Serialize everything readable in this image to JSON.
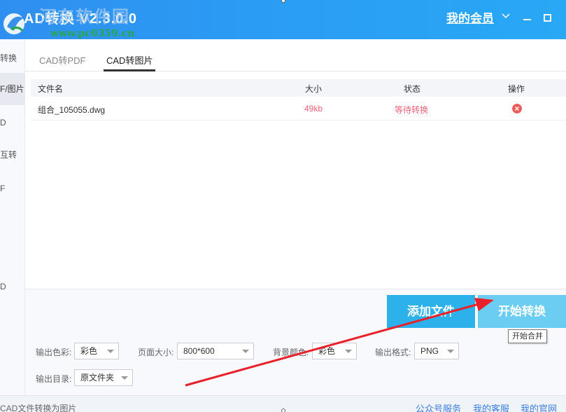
{
  "titlebar": {
    "app_title": "AD转换 V2.3.0.0",
    "watermark_site": "河东软件园",
    "watermark_url": "www.pc0359.cn",
    "member_link": "我的会员",
    "colors": {
      "bg": "#2a9df4",
      "text": "#ffffff"
    }
  },
  "sidebar": {
    "items": [
      {
        "label": "转换"
      },
      {
        "label": "F/图片",
        "active": true
      },
      {
        "label": "D"
      },
      {
        "label": "互转"
      },
      {
        "label": "F"
      },
      {
        "label": "D"
      }
    ]
  },
  "tabs": [
    {
      "label": "CAD转PDF"
    },
    {
      "label": "CAD转图片",
      "active": true
    }
  ],
  "table": {
    "headers": {
      "name": "文件名",
      "size": "大小",
      "status": "状态",
      "action": "操作"
    },
    "rows": [
      {
        "name": "组合_105055.dwg",
        "size": "49kb",
        "status": "等待转换",
        "action_icon": "delete-icon"
      }
    ],
    "colors": {
      "size": "#f0627a",
      "status": "#f0627a",
      "delete": "#ef5a5a"
    }
  },
  "actions": {
    "add_file": "添加文件",
    "start": "开始转换",
    "tooltip": "开始合并"
  },
  "options": {
    "color_mode": {
      "label": "输出色彩:",
      "value": "彩色"
    },
    "page_size": {
      "label": "页面大小:",
      "value": "800*600"
    },
    "bg_color": {
      "label": "背景颜色:",
      "value": "彩色"
    },
    "format": {
      "label": "输出格式:",
      "value": "PNG"
    },
    "output_dir": {
      "label": "输出目录:",
      "value": "原文件夹"
    }
  },
  "statusbar": {
    "text": "CAD文件转换为图片",
    "links": [
      "公众号服务",
      "我的客服",
      "我的官网"
    ]
  }
}
